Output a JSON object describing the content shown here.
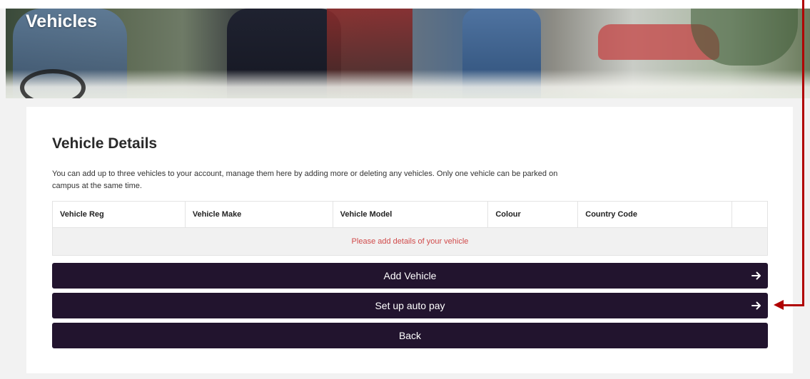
{
  "hero": {
    "title": "Vehicles"
  },
  "details": {
    "title": "Vehicle Details",
    "intro": "You can add up to three vehicles to your account, manage them here by adding more or deleting any vehicles. Only one vehicle can be parked on campus at the same time."
  },
  "table": {
    "columns": [
      "Vehicle Reg",
      "Vehicle Make",
      "Vehicle Model",
      "Colour",
      "Country Code",
      ""
    ],
    "empty_message": "Please add details of your vehicle"
  },
  "buttons": {
    "add_vehicle": "Add Vehicle",
    "auto_pay": "Set up auto pay",
    "back": "Back"
  },
  "icons": {
    "button_arrow": "arrow-right-icon",
    "annotation": "annotation-arrow-icon"
  },
  "colors": {
    "button_bg": "#22142e",
    "empty_message": "#d14b4b",
    "annotation": "#b00000"
  }
}
